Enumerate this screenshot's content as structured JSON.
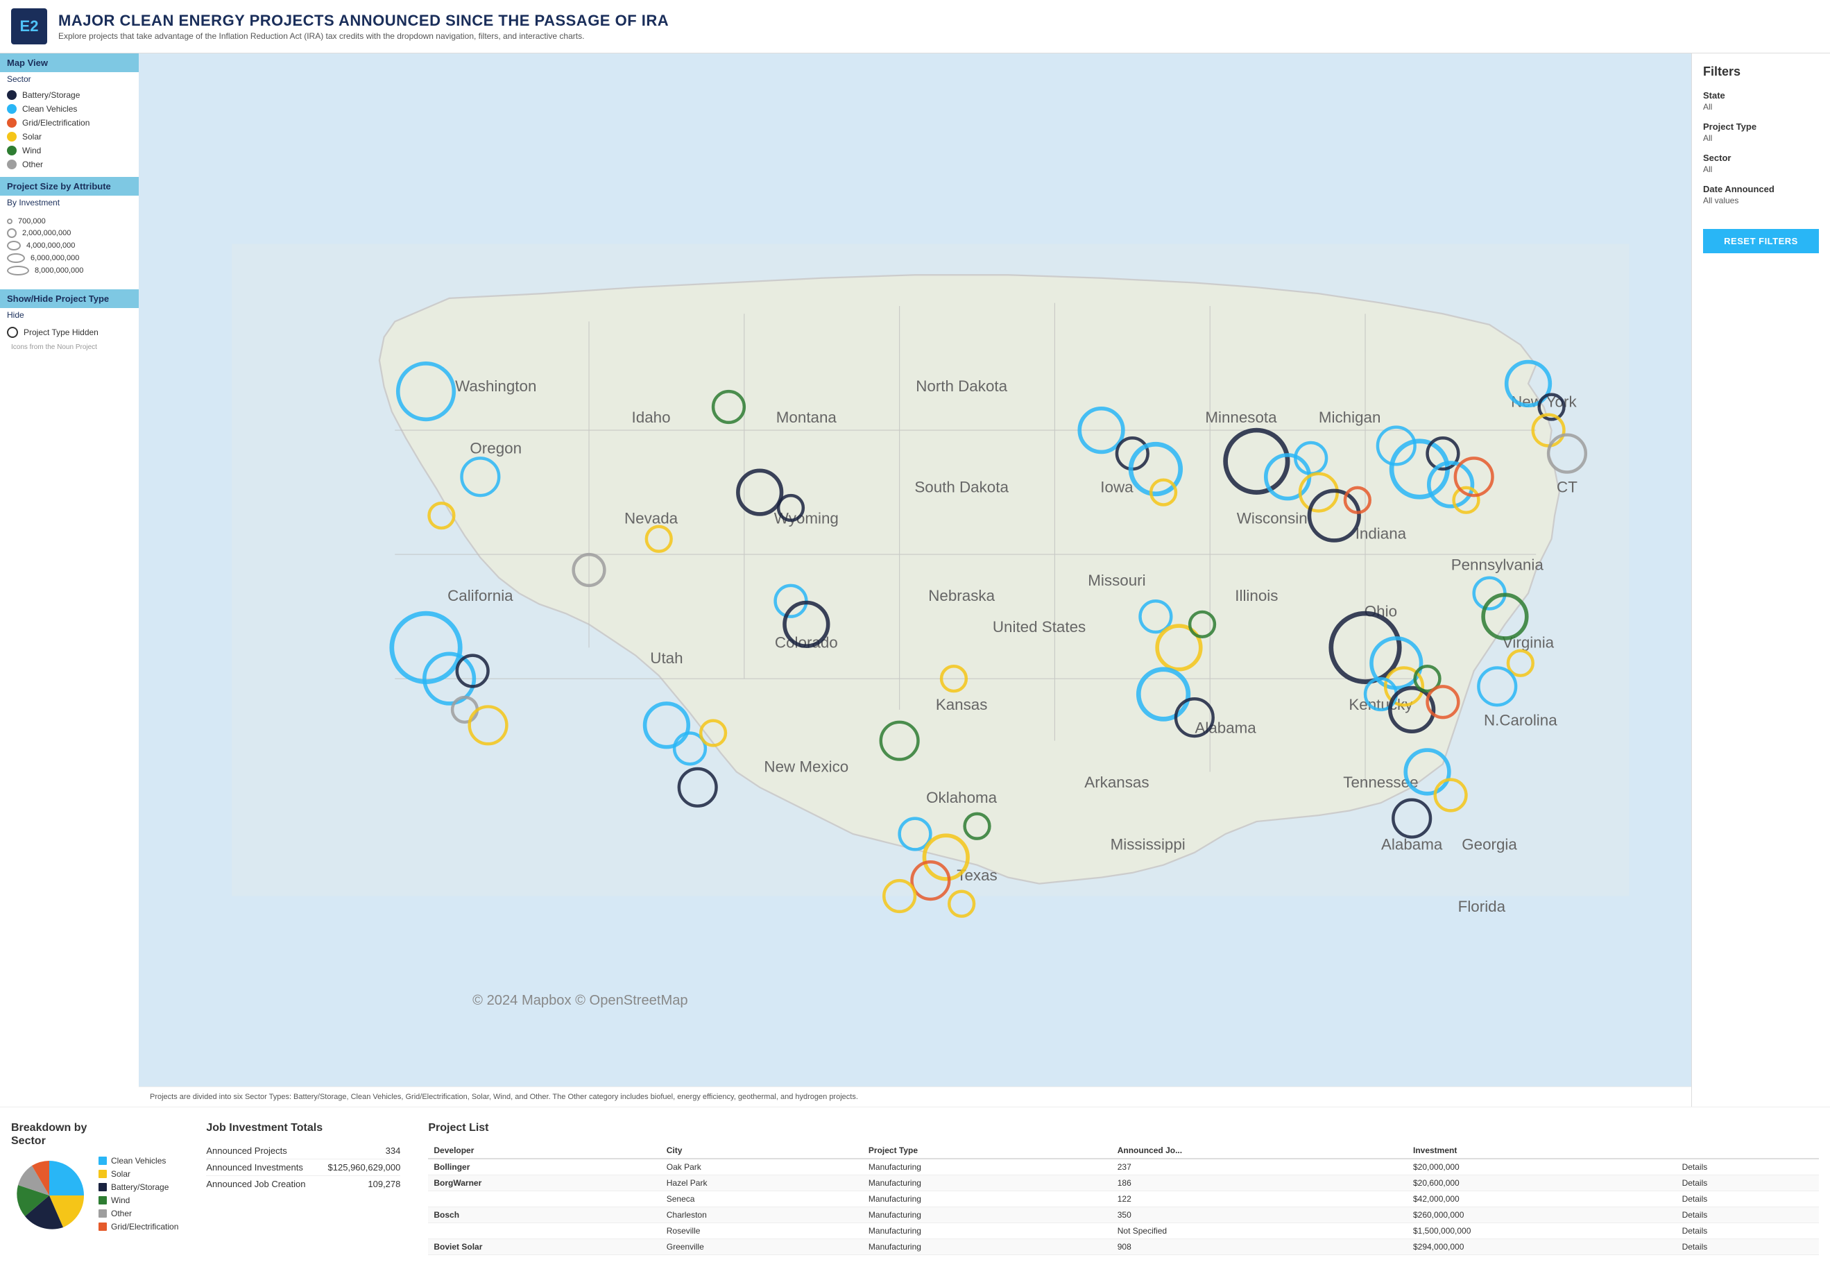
{
  "header": {
    "logo": "E2",
    "title": "MAJOR CLEAN ENERGY PROJECTS ANNOUNCED SINCE THE PASSAGE OF IRA",
    "subtitle": "Explore projects that take advantage of the Inflation Reduction Act (IRA) tax credits with the dropdown navigation, filters, and interactive charts."
  },
  "left_sidebar": {
    "map_view": {
      "label": "Map View",
      "sub": "Sector"
    },
    "legend": [
      {
        "id": "battery",
        "label": "Battery/Storage",
        "color": "#1a2340"
      },
      {
        "id": "clean-vehicles",
        "label": "Clean Vehicles",
        "color": "#29b6f6"
      },
      {
        "id": "grid",
        "label": "Grid/Electrification",
        "color": "#e55a2b"
      },
      {
        "id": "solar",
        "label": "Solar",
        "color": "#f5c518"
      },
      {
        "id": "wind",
        "label": "Wind",
        "color": "#2e7d32"
      },
      {
        "id": "other",
        "label": "Other",
        "color": "#9e9e9e"
      }
    ],
    "project_size": {
      "label": "Project Size by Attribute",
      "sub": "By Investment"
    },
    "size_legend": [
      {
        "size": 6,
        "label": "700,000"
      },
      {
        "size": 10,
        "label": "2,000,000,000"
      },
      {
        "size": 14,
        "label": "4,000,000,000"
      },
      {
        "size": 18,
        "label": "6,000,000,000"
      },
      {
        "size": 22,
        "label": "8,000,000,000"
      }
    ],
    "show_hide": {
      "label": "Show/Hide Project Type",
      "sub": "Hide",
      "hidden_label": "Project Type Hidden"
    }
  },
  "filters": {
    "title": "Filters",
    "state": {
      "label": "State",
      "value": "All"
    },
    "project_type": {
      "label": "Project Type",
      "value": "All"
    },
    "sector": {
      "label": "Sector",
      "value": "All"
    },
    "date_announced": {
      "label": "Date Announced",
      "value": "All values"
    },
    "reset_button": "RESET FILTERS"
  },
  "map": {
    "credit": "© 2024 Mapbox © OpenStreetMap",
    "note": "Projects are divided into six Sector Types: Battery/Storage, Clean Vehicles, Grid/Electrification, Solar, Wind, and Other. The Other category includes biofuel, energy efficiency, geothermal, and hydrogen projects."
  },
  "breakdown": {
    "title": "Breakdown by\nSector",
    "legend": [
      {
        "label": "Clean Vehicles",
        "color": "#29b6f6"
      },
      {
        "label": "Solar",
        "color": "#f5c518"
      },
      {
        "label": "Battery/Storage",
        "color": "#1a2340"
      },
      {
        "label": "Wind",
        "color": "#2e7d32"
      },
      {
        "label": "Other",
        "color": "#9e9e9e"
      },
      {
        "label": "Grid/Electrification",
        "color": "#e55a2b"
      }
    ]
  },
  "job_investment": {
    "title": "Job Investment Totals",
    "rows": [
      {
        "label": "Announced Projects",
        "value": "334"
      },
      {
        "label": "Announced Investments",
        "value": "$125,960,629,000"
      },
      {
        "label": "Announced Job Creation",
        "value": "109,278"
      }
    ]
  },
  "project_list": {
    "title": "Project List",
    "columns": [
      "Developer",
      "City",
      "Project Type",
      "Announced Jo...",
      "Investment",
      ""
    ],
    "rows": [
      {
        "developer": "Bollinger",
        "city": "Oak Park",
        "type": "Manufacturing",
        "jobs": "237",
        "investment": "$20,000,000",
        "action": "Details"
      },
      {
        "developer": "BorgWarner",
        "city": "Hazel Park",
        "type": "Manufacturing",
        "jobs": "186",
        "investment": "$20,600,000",
        "action": "Details"
      },
      {
        "developer": "",
        "city": "Seneca",
        "type": "Manufacturing",
        "jobs": "122",
        "investment": "$42,000,000",
        "action": "Details"
      },
      {
        "developer": "Bosch",
        "city": "Charleston",
        "type": "Manufacturing",
        "jobs": "350",
        "investment": "$260,000,000",
        "action": "Details"
      },
      {
        "developer": "",
        "city": "Roseville",
        "type": "Manufacturing",
        "jobs": "Not Specified",
        "investment": "$1,500,000,000",
        "action": "Details"
      },
      {
        "developer": "Boviet Solar",
        "city": "Greenville",
        "type": "Manufacturing",
        "jobs": "908",
        "investment": "$294,000,000",
        "action": "Details"
      }
    ]
  },
  "noun_note": "Icons from the Noun Project"
}
